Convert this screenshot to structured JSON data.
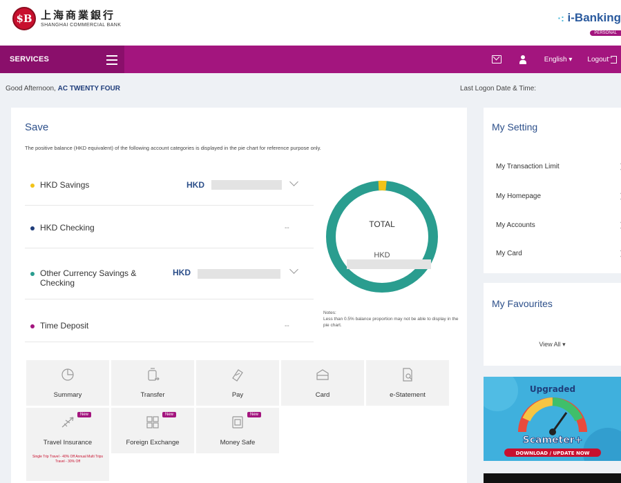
{
  "header": {
    "bank_name_cn": "上海商業銀行",
    "bank_name_en": "SHANGHAI COMMERCIAL BANK",
    "logo_mark": "$B",
    "product": "i-Banking",
    "product_tier": "PERSONAL"
  },
  "nav": {
    "services_label": "SERVICES",
    "language_label": "English ▾",
    "logout_label": "Logout"
  },
  "greeting": {
    "prefix": "Good Afternoon, ",
    "name": "AC TWENTY FOUR",
    "last_logon_label": "Last Logon Date & Time:"
  },
  "save": {
    "title": "Save",
    "description": "The positive balance (HKD equivalent) of the following account categories is displayed in the pie chart for reference purpose only.",
    "accounts": [
      {
        "name": "HKD Savings",
        "currency": "HKD",
        "value": "",
        "dot_color": "#f2c318",
        "expandable": true
      },
      {
        "name": "HKD Checking",
        "currency": "",
        "value": "--",
        "dot_color": "#1f3d7a",
        "expandable": false
      },
      {
        "name": "Other Currency Savings & Checking",
        "currency": "HKD",
        "value": "",
        "dot_color": "#2a9d8f",
        "expandable": true
      },
      {
        "name": "Time Deposit",
        "currency": "",
        "value": "--",
        "dot_color": "#a3157e",
        "expandable": false
      }
    ],
    "donut": {
      "total_label": "TOTAL",
      "currency": "HKD",
      "ring_color": "#2a9d8f",
      "highlight_color": "#f2c318"
    },
    "notes_title": "Notes:",
    "notes_text": "Less than 0.5% balance proportion may not be able to display in the pie chart."
  },
  "tiles": [
    {
      "label": "Summary",
      "icon": "clock-chart-icon",
      "new": false
    },
    {
      "label": "Transfer",
      "icon": "transfer-icon",
      "new": false
    },
    {
      "label": "Pay",
      "icon": "pay-icon",
      "new": false
    },
    {
      "label": "Card",
      "icon": "card-icon",
      "new": false
    },
    {
      "label": "e-Statement",
      "icon": "statement-icon",
      "new": false
    },
    {
      "label": "Travel Insurance",
      "icon": "plane-icon",
      "new": true,
      "promo": "Single Trip Travel - 40% Off Annual Multi Trips Travel - 30% Off"
    },
    {
      "label": "Foreign Exchange",
      "icon": "exchange-icon",
      "new": true
    },
    {
      "label": "Money Safe",
      "icon": "safe-icon",
      "new": true
    }
  ],
  "new_badge": "New",
  "my_setting": {
    "title": "My Setting",
    "items": [
      "My Transaction Limit",
      "My Homepage",
      "My Accounts",
      "My Card"
    ]
  },
  "my_favourites": {
    "title": "My Favourites",
    "view_all": "View All ▾"
  },
  "banner": {
    "headline": "Upgraded",
    "product": "Scameter+",
    "cta": "DOWNLOAD / UPDATE NOW"
  },
  "colors": {
    "brand_magenta": "#a3157e",
    "brand_blue": "#2c4f8a",
    "chart_teal": "#2a9d8f",
    "chart_yellow": "#f2c318"
  }
}
